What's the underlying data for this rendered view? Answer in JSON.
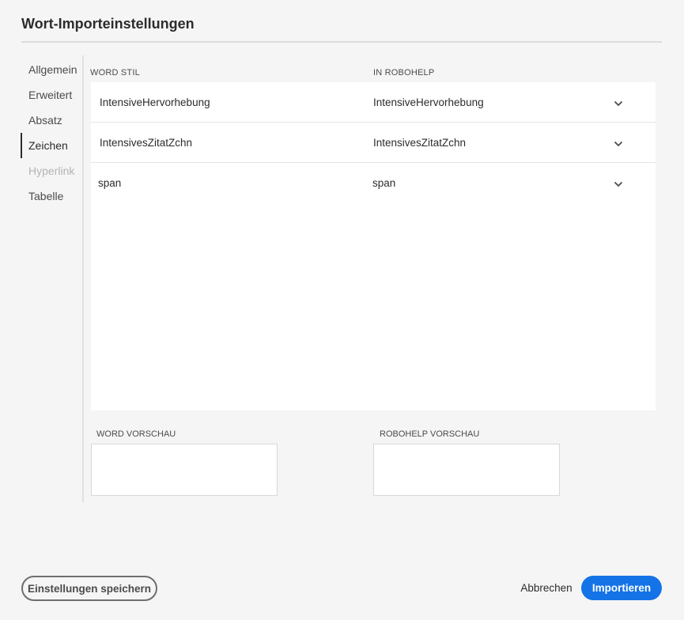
{
  "dialog": {
    "title": "Wort-Importeinstellungen"
  },
  "sidebar": {
    "items": [
      {
        "label": "Allgemein"
      },
      {
        "label": "Erweitert"
      },
      {
        "label": "Absatz"
      },
      {
        "label": "Zeichen"
      },
      {
        "label": "Hyperlink"
      },
      {
        "label": "Tabelle"
      }
    ],
    "active": "Zeichen",
    "disabled": [
      "Hyperlink"
    ]
  },
  "table": {
    "columns": {
      "word": "WORD STIL",
      "robohelp": "IN ROBOHELP"
    },
    "rows": [
      {
        "word_style": "IntensiveHervorhebung",
        "robohelp_style": "IntensiveHervorhebung",
        "icon": "chevron-down-icon"
      },
      {
        "word_style": "IntensivesZitatZchn",
        "robohelp_style": "IntensivesZitatZchn",
        "icon": "chevron-down-icon"
      },
      {
        "word_style": "span",
        "robohelp_style": "span",
        "icon": "chevron-down-icon"
      }
    ]
  },
  "preview": {
    "word_label": "WORD VORSCHAU",
    "robohelp_label": "ROBOHELP VORSCHAU"
  },
  "footer": {
    "save_label": "Einstellungen speichern",
    "cancel_label": "Abbrechen",
    "import_label": "Importieren"
  },
  "colors": {
    "accent": "#1473e6",
    "background": "#f5f5f5",
    "text": "#2c2c2c",
    "disabled": "#b3b3b3"
  }
}
